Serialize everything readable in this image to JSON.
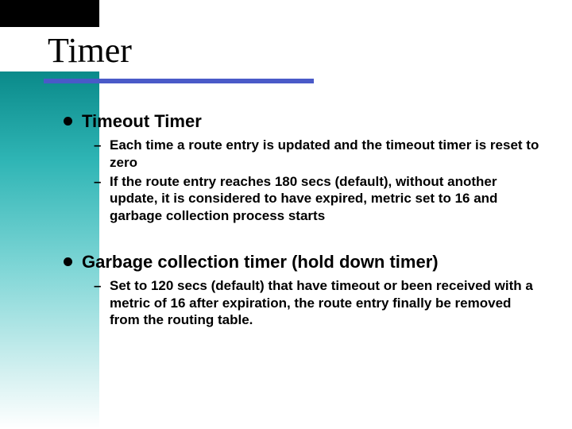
{
  "title": "Timer",
  "items": [
    {
      "heading": "Timeout Timer",
      "subs": [
        "Each time a route entry is updated and the timeout timer is reset to zero",
        "If the route entry reaches 180 secs (default), without another update, it is considered to have expired, metric set to 16 and garbage collection process starts"
      ]
    },
    {
      "heading": "Garbage collection timer (hold down timer)",
      "subs": [
        "Set to 120 secs (default) that have timeout or been received with a metric of 16 after expiration, the route entry finally be removed from the routing table."
      ]
    }
  ]
}
